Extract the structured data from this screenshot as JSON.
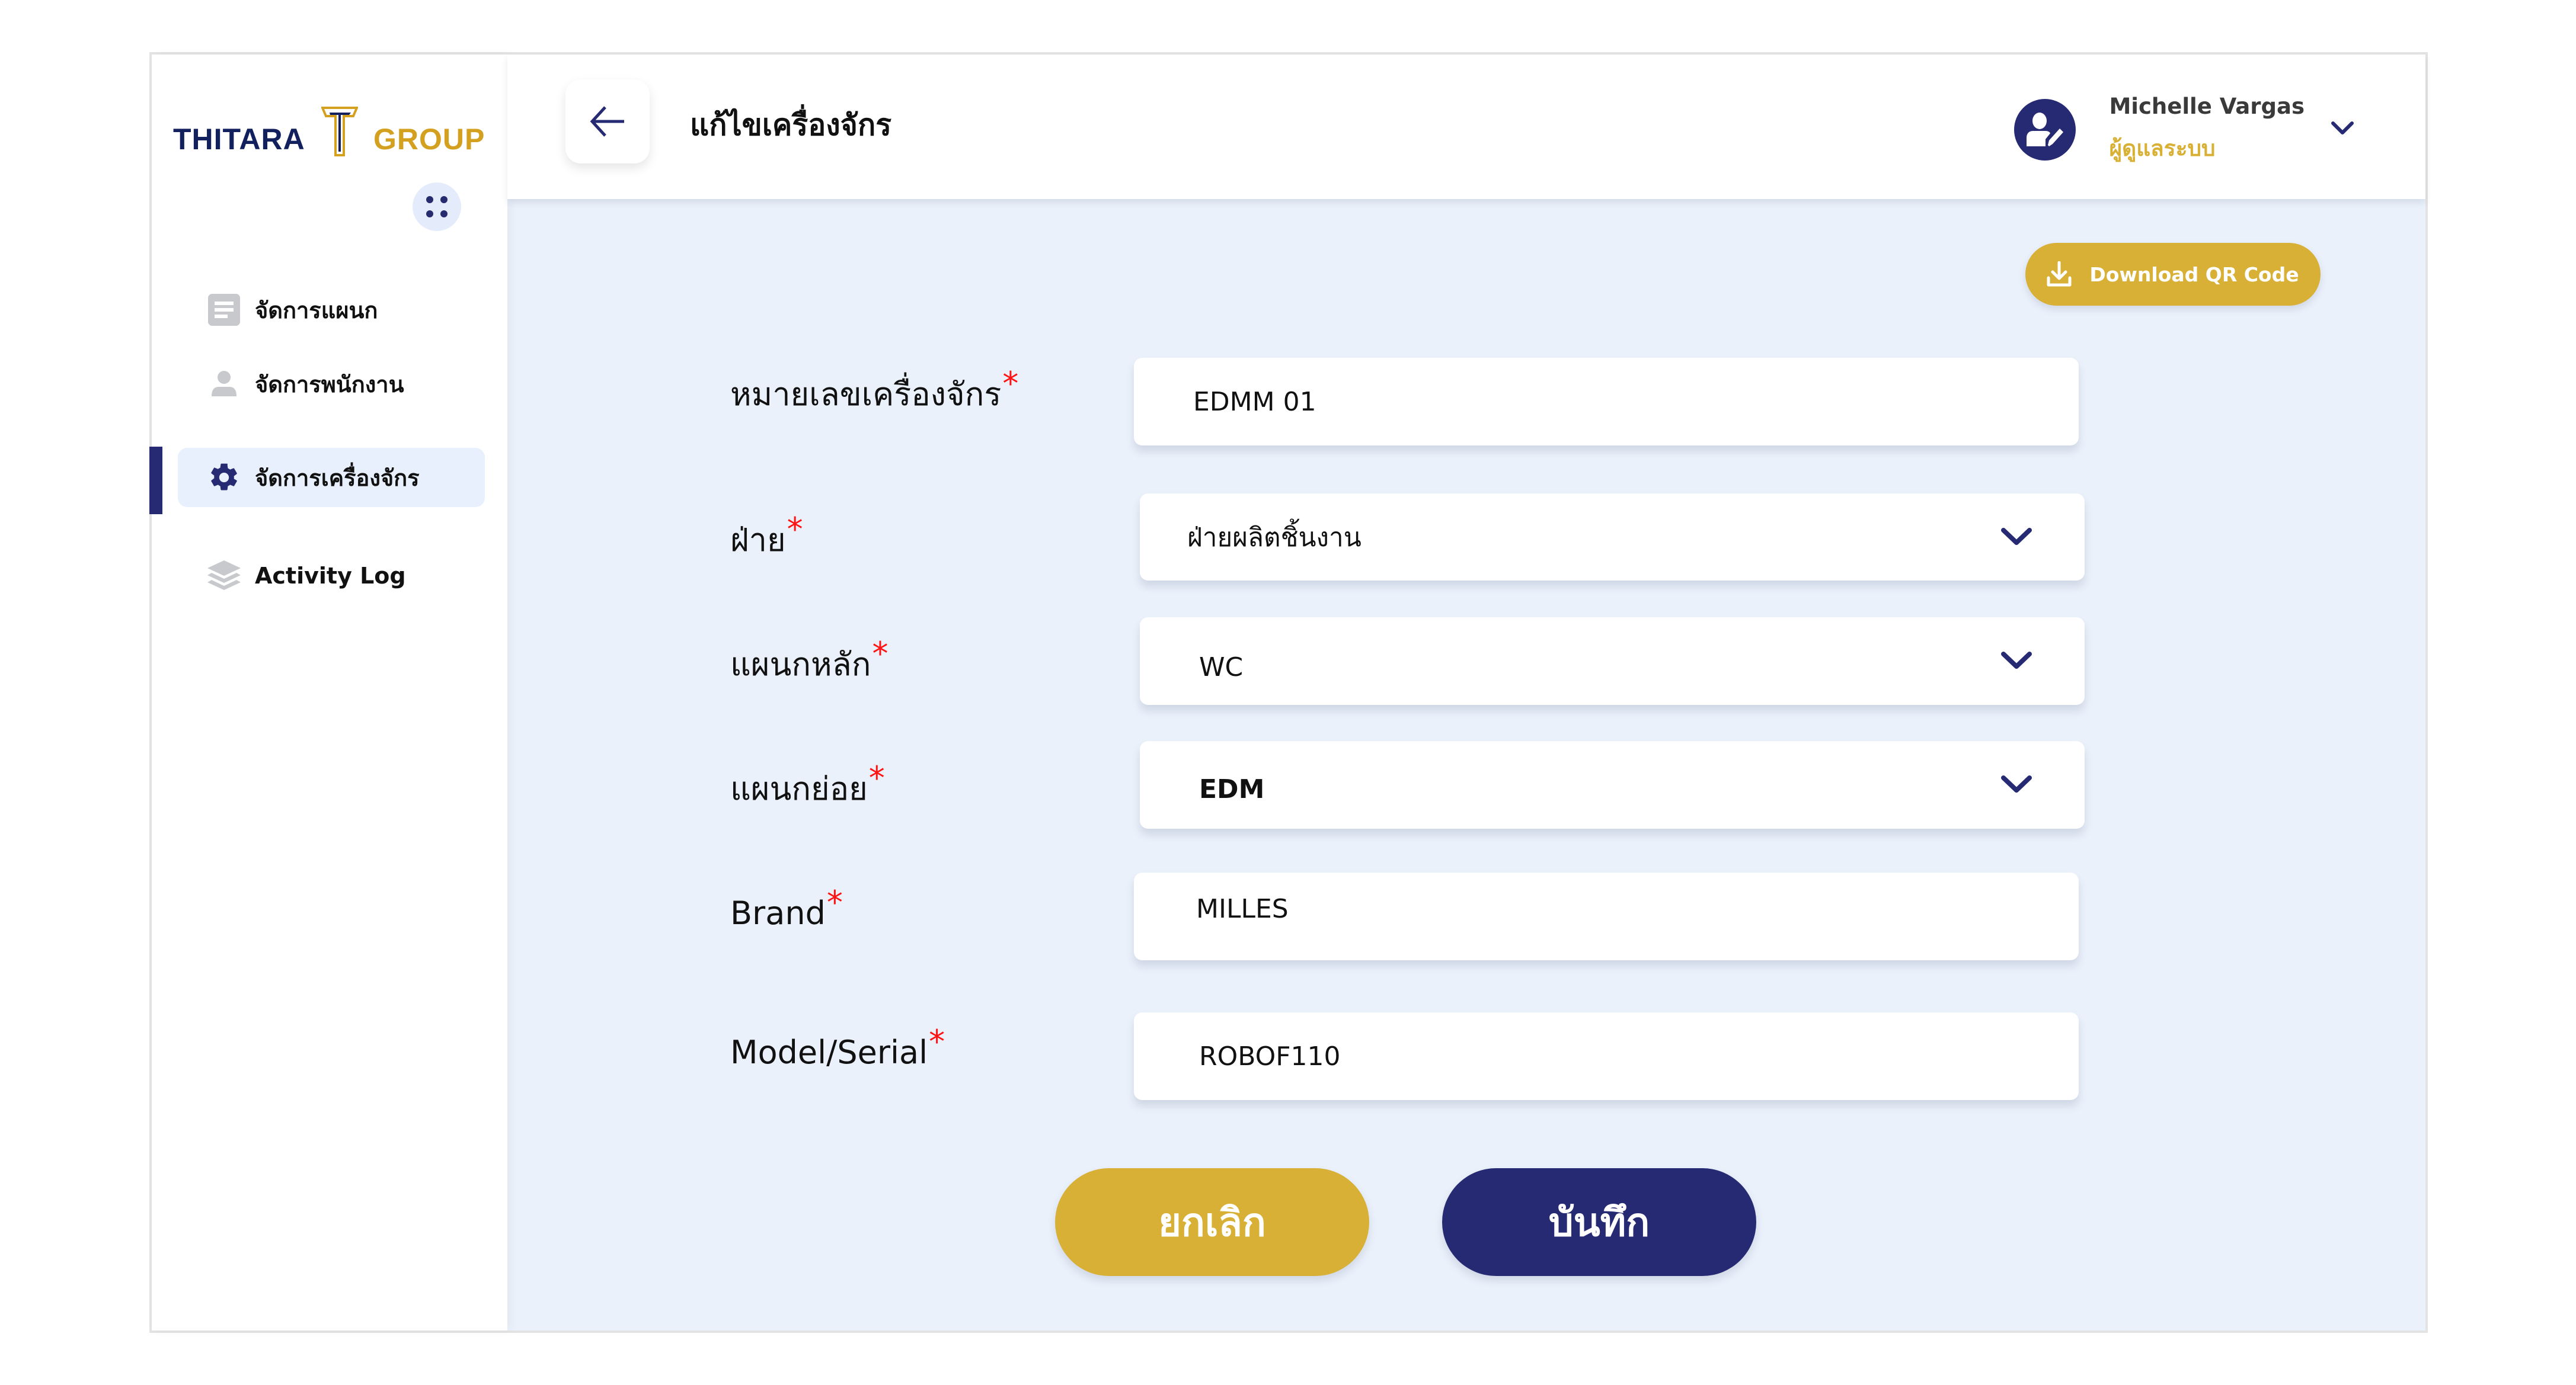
{
  "brand": {
    "logo_left": "THITARA",
    "logo_right": "GROUP",
    "colors": {
      "navy": "#262a73",
      "gold": "#d8b036",
      "background": "#eaf1fb",
      "required": "#ff1212"
    }
  },
  "sidebar": {
    "items": [
      {
        "label": "จัดการแผนก",
        "icon": "document-icon",
        "active": false
      },
      {
        "label": "จัดการพนักงาน",
        "icon": "user-icon",
        "active": false
      },
      {
        "label": "จัดการเครื่องจักร",
        "icon": "gear-icon",
        "active": true
      },
      {
        "label": "Activity Log",
        "icon": "layers-icon",
        "active": false
      }
    ]
  },
  "header": {
    "title": "แก้ไขเครื่องจักร",
    "user": {
      "name": "Michelle Vargas",
      "role": "ผู้ดูแลระบบ"
    }
  },
  "actions": {
    "download_qr": "Download QR Code",
    "cancel": "ยกเลิก",
    "save": "บันทึก"
  },
  "form": {
    "required_mark": "*",
    "fields": [
      {
        "label": "หมายเลขเครื่องจักร",
        "type": "text",
        "value": "EDMM 01"
      },
      {
        "label": "ฝ่าย",
        "type": "select",
        "value": "ฝ่ายผลิตชิ้นงาน"
      },
      {
        "label": "แผนกหลัก",
        "type": "select",
        "value": "WC"
      },
      {
        "label": "แผนกย่อย",
        "type": "select",
        "value": "EDM"
      },
      {
        "label": "Brand",
        "type": "text",
        "value": "MILLES"
      },
      {
        "label": "Model/Serial",
        "type": "text",
        "value": "ROBOF110"
      }
    ]
  }
}
